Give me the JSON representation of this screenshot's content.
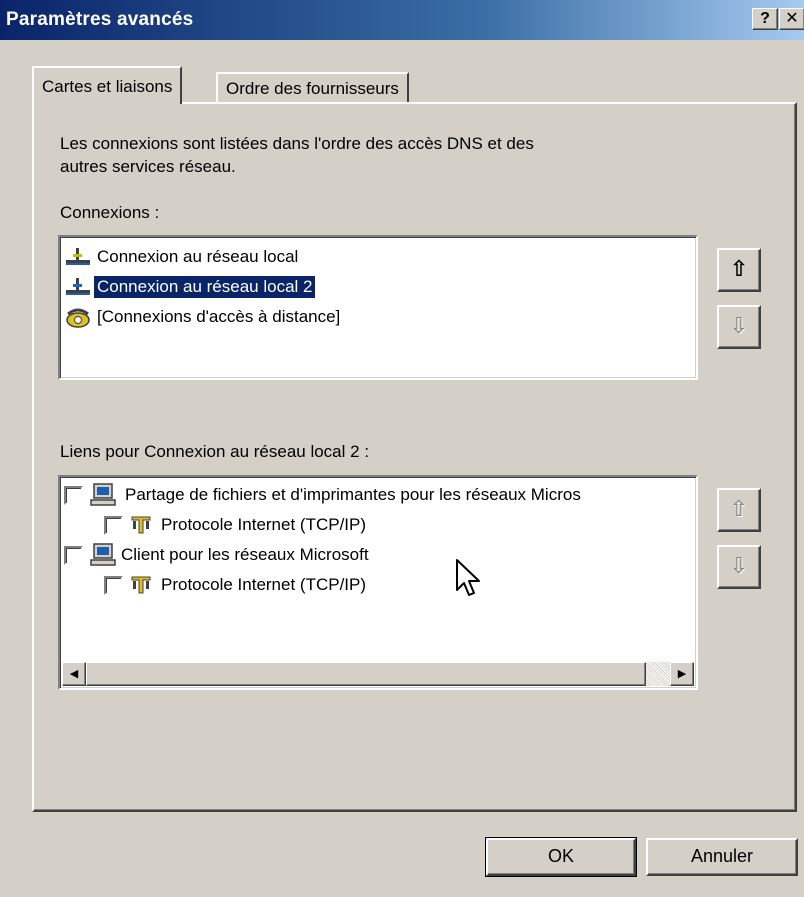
{
  "window": {
    "title": "Paramètres avancés",
    "help_label": "?",
    "close_label": "✕"
  },
  "tabs": [
    {
      "label": "Cartes et liaisons",
      "active": true
    },
    {
      "label": "Ordre des fournisseurs",
      "active": false
    }
  ],
  "description": {
    "line1": "Les connexions sont listées dans l'ordre des accès DNS et des",
    "line2": "autres services réseau."
  },
  "connections": {
    "label": "Connexions :",
    "items": [
      {
        "label": "Connexion au réseau local",
        "icon": "network-connection-icon",
        "selected": false
      },
      {
        "label": "Connexion au réseau local 2",
        "icon": "network-connection-icon",
        "selected": true
      },
      {
        "label": "[Connexions d'accès à distance]",
        "icon": "dialup-phone-icon",
        "selected": false
      }
    ],
    "move_up": {
      "glyph": "⇧",
      "enabled": true
    },
    "move_down": {
      "glyph": "⇩",
      "enabled": false
    }
  },
  "bindings": {
    "label": "Liens pour Connexion au réseau local 2 :",
    "items": [
      {
        "label": "Partage de fichiers et d'imprimantes pour les réseaux Micros",
        "icon": "computer-icon",
        "level": 0,
        "checked": false
      },
      {
        "label": "Protocole Internet (TCP/IP)",
        "icon": "protocol-icon",
        "level": 1,
        "checked": false
      },
      {
        "label": "Client pour les réseaux Microsoft",
        "icon": "computer-icon",
        "level": 0,
        "checked": false
      },
      {
        "label": "Protocole Internet (TCP/IP)",
        "icon": "protocol-icon",
        "level": 1,
        "checked": false
      }
    ],
    "move_up": {
      "glyph": "⇧",
      "enabled": false
    },
    "move_down": {
      "glyph": "⇩",
      "enabled": false
    }
  },
  "buttons": {
    "ok": "OK",
    "cancel": "Annuler"
  },
  "colors": {
    "titlebar_start": "#0a246a",
    "titlebar_end": "#a6caf0",
    "face": "#d4d0c8",
    "selection": "#0a246a"
  }
}
